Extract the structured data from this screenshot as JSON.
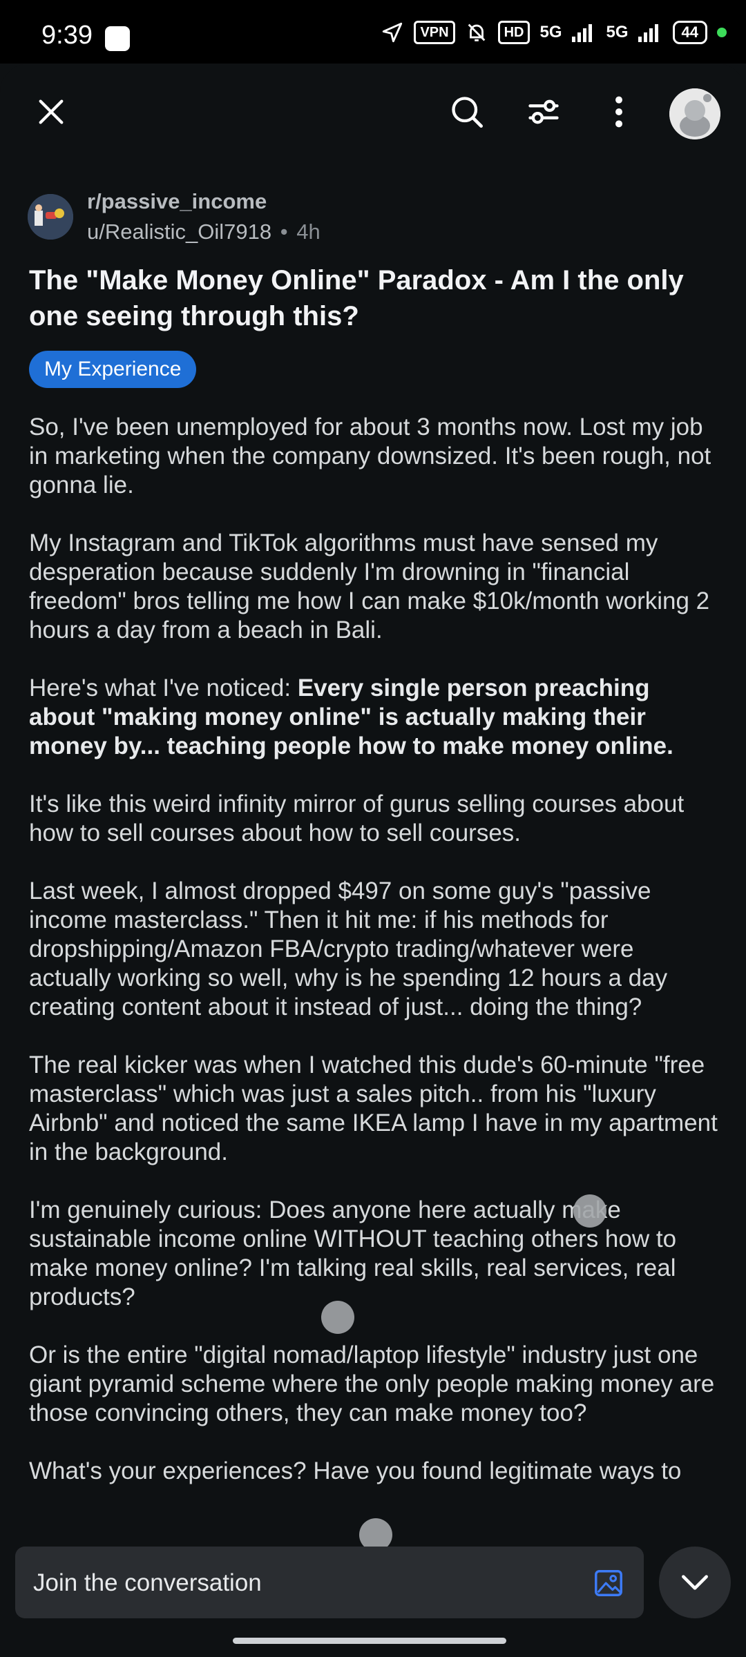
{
  "status_bar": {
    "time": "9:39",
    "vpn": "VPN",
    "hd": "HD",
    "net1": "5G",
    "net2": "5G",
    "battery": "44"
  },
  "toolbar": {
    "close_icon": "close-icon",
    "search_icon": "search-icon",
    "sort_icon": "sort-toggle-icon",
    "more_icon": "more-vertical-icon",
    "avatar_icon": "user-avatar-icon"
  },
  "post": {
    "subreddit": "r/passive_income",
    "author": "u/Realistic_Oil7918",
    "separator": "•",
    "age": "4h",
    "title": "The \"Make Money Online\" Paradox - Am I the only one seeing through this?",
    "flair": "My Experience",
    "body": {
      "p1": "So, I've been unemployed for about 3 months now. Lost my job in marketing when the company downsized. It's been rough, not gonna lie.",
      "p2": "My Instagram and TikTok algorithms must have sensed my desperation because suddenly I'm drowning in \"financial freedom\" bros telling me how I can make $10k/month working 2 hours a day from a beach in Bali.",
      "p3_lead": "Here's what I've noticed: ",
      "p3_bold": "Every single person preaching about \"making money online\" is actually making their money by... teaching people how to make money online.",
      "p4": "It's like this weird infinity mirror of gurus selling courses about how to sell courses about how to sell courses.",
      "p5": "Last week, I almost dropped $497 on some guy's \"passive income masterclass.\" Then it hit me: if his methods for dropshipping/Amazon FBA/crypto trading/whatever were actually working so well, why is he spending 12 hours a day creating content about it instead of just... doing the thing?",
      "p6": "The real kicker was when I watched this dude's 60-minute \"free masterclass\" which was just a sales pitch.. from his \"luxury Airbnb\" and noticed the same IKEA lamp I have in my apartment in the background.",
      "p7": "I'm genuinely curious: Does anyone here actually make sustainable income online WITHOUT teaching others how to make money online? I'm talking real skills, real services, real products?",
      "p8": "Or is the entire \"digital nomad/laptop lifestyle\" industry just one giant pyramid scheme where the only people making money are those convincing others, they can make money too?",
      "p9": "What's your experiences? Have you found legitimate ways to"
    }
  },
  "composer": {
    "placeholder": "Join the conversation",
    "image_icon": "add-image-icon",
    "collapse_icon": "chevron-down-icon"
  },
  "colors": {
    "background": "#0e1113",
    "flair": "#1f6fd6",
    "accent_blue": "#3d7bf7",
    "composer": "#2a2d31"
  }
}
